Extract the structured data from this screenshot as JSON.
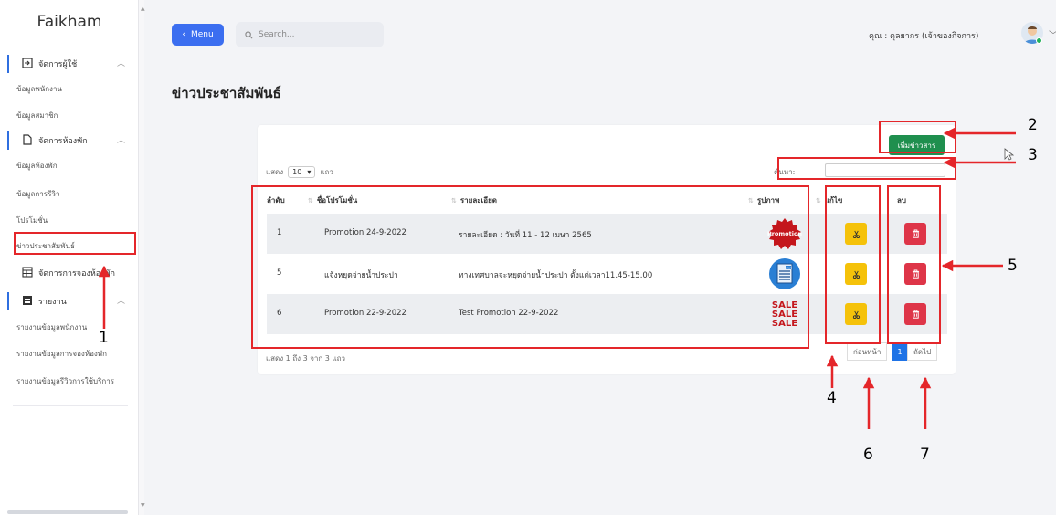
{
  "sidebar": {
    "brand": "Faikham",
    "groups": [
      {
        "label": "จัดการผู้ใช้",
        "icon": "user-manage-icon",
        "items": [
          "ข้อมูลพนักงาน",
          "ข้อมูลสมาชิก"
        ]
      },
      {
        "label": "จัดการห้องพัก",
        "icon": "document-icon",
        "items": [
          "ข้อมูลห้องพัก",
          "ข้อมูลการรีวิว",
          "โปรโมชั่น",
          "ข่าวประชาสัมพันธ์"
        ]
      },
      {
        "label": "จัดการการจองห้องพัก",
        "icon": "table-grid-icon",
        "items": []
      },
      {
        "label": "รายงาน",
        "icon": "report-icon",
        "items": [
          "รายงานข้อมูลพนักงาน",
          "รายงานข้อมูลการจองห้องพัก",
          "รายงานข้อมูลรีวิวการใช้บริการ"
        ]
      }
    ]
  },
  "topbar": {
    "menu_label": "Menu",
    "search_placeholder": "Search...",
    "user_label": "คุณ : ดุลยากร (เจ้าของกิจการ)"
  },
  "page": {
    "title": "ข่าวประชาสัมพันธ์",
    "add_button": "เพิ่มข่าวสาร",
    "length_prefix": "แสดง",
    "length_value": "10",
    "length_suffix": "แถว",
    "search_label": "ค้นหา:",
    "info": "แสดง 1 ถึง 3 จาก 3 แถว",
    "prev": "ก่อนหน้า",
    "current_page": "1",
    "next": "ถัดไป"
  },
  "table": {
    "columns": [
      "ลำดับ",
      "ชื่อโปรโมชั่น",
      "รายละเอียด",
      "รูปภาพ",
      "แก้ไข",
      "ลบ"
    ],
    "rows": [
      {
        "no": "1",
        "name": "Promotion 24-9-2022",
        "detail": "รายละเอียด : วันที่ 11 - 12 เมษา 2565",
        "image": "Promotion"
      },
      {
        "no": "5",
        "name": "แจ้งหยุดจ่ายน้ำประปา",
        "detail": "ทางเทศบาลจะหยุดจ่ายน้ำประปา ตั้งแต่เวลา11.45-15.00",
        "image": "NEWS"
      },
      {
        "no": "6",
        "name": "Promotion 22-9-2022",
        "detail": "Test Promotion 22-9-2022",
        "image": "SALE"
      }
    ]
  },
  "annotations": [
    "1",
    "2",
    "3",
    "4",
    "5",
    "6",
    "7"
  ],
  "colors": {
    "primary": "#3b6ef0",
    "success": "#1f8f4e",
    "warning": "#f5c20a",
    "danger": "#de3548",
    "annotation": "#e4262a"
  }
}
